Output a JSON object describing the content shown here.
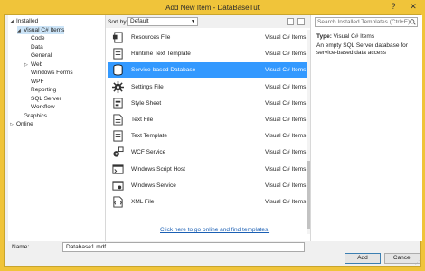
{
  "window": {
    "title": "Add New Item - DataBaseTut",
    "help_glyph": "?",
    "close_glyph": "✕"
  },
  "tree": {
    "items": [
      {
        "label": "Installed",
        "toggle": "◢",
        "indent": 0,
        "selected": false
      },
      {
        "label": "Visual C# Items",
        "toggle": "◢",
        "indent": 1,
        "selected": true
      },
      {
        "label": "Code",
        "toggle": "",
        "indent": 2,
        "selected": false
      },
      {
        "label": "Data",
        "toggle": "",
        "indent": 2,
        "selected": false
      },
      {
        "label": "General",
        "toggle": "",
        "indent": 2,
        "selected": false
      },
      {
        "label": "Web",
        "toggle": "▷",
        "indent": 2,
        "selected": false
      },
      {
        "label": "Windows Forms",
        "toggle": "",
        "indent": 2,
        "selected": false
      },
      {
        "label": "WPF",
        "toggle": "",
        "indent": 2,
        "selected": false
      },
      {
        "label": "Reporting",
        "toggle": "",
        "indent": 2,
        "selected": false
      },
      {
        "label": "SQL Server",
        "toggle": "",
        "indent": 2,
        "selected": false
      },
      {
        "label": "Workflow",
        "toggle": "",
        "indent": 2,
        "selected": false
      },
      {
        "label": "Graphics",
        "toggle": "",
        "indent": 1,
        "selected": false
      },
      {
        "label": "Online",
        "toggle": "▷",
        "indent": 0,
        "selected": false
      }
    ]
  },
  "sort": {
    "label": "Sort by:",
    "value": "Default",
    "arrow": "▼"
  },
  "templates": [
    {
      "name": "Resources File",
      "category": "Visual C# Items",
      "icon": "resources-file-icon",
      "selected": false
    },
    {
      "name": "Runtime Text Template",
      "category": "Visual C# Items",
      "icon": "text-template-icon",
      "selected": false
    },
    {
      "name": "Service-based Database",
      "category": "Visual C# Items",
      "icon": "database-icon",
      "selected": true
    },
    {
      "name": "Settings File",
      "category": "Visual C# Items",
      "icon": "settings-gear-icon",
      "selected": false
    },
    {
      "name": "Style Sheet",
      "category": "Visual C# Items",
      "icon": "style-sheet-icon",
      "selected": false
    },
    {
      "name": "Text File",
      "category": "Visual C# Items",
      "icon": "text-file-icon",
      "selected": false
    },
    {
      "name": "Text Template",
      "category": "Visual C# Items",
      "icon": "text-template-icon",
      "selected": false
    },
    {
      "name": "WCF Service",
      "category": "Visual C# Items",
      "icon": "wcf-service-icon",
      "selected": false
    },
    {
      "name": "Windows Script Host",
      "category": "Visual C# Items",
      "icon": "script-host-icon",
      "selected": false
    },
    {
      "name": "Windows Service",
      "category": "Visual C# Items",
      "icon": "windows-service-icon",
      "selected": false
    },
    {
      "name": "XML File",
      "category": "Visual C# Items",
      "icon": "xml-file-icon",
      "selected": false
    }
  ],
  "online_link": "Click here to go online and find templates.",
  "search": {
    "placeholder": "Search Installed Templates (Ctrl+E)"
  },
  "details": {
    "type_label": "Type:",
    "type_value": "Visual C# Items",
    "description": "An empty SQL Server database for service-based data access"
  },
  "name_field": {
    "label": "Name:",
    "value": "Database1.mdf"
  },
  "buttons": {
    "add": "Add",
    "cancel": "Cancel"
  },
  "colors": {
    "title_bar": "#f0c43a",
    "selection": "#3399ff",
    "tree_selection": "#cce4f7",
    "link": "#1a5fb4"
  }
}
